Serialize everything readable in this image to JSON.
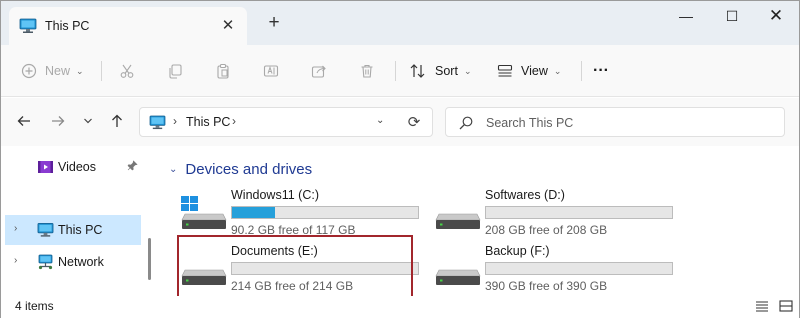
{
  "tab": {
    "title": "This PC",
    "icon": "this-pc-icon",
    "close": "✕"
  },
  "new_tab": "+",
  "window_controls": {
    "minimize": "—",
    "maximize": "☐",
    "close": "✕"
  },
  "commands": {
    "new_label": "New",
    "sort_label": "Sort",
    "view_label": "View",
    "more": "···",
    "icons": [
      "new-icon",
      "cut-icon",
      "copy-icon",
      "paste-icon",
      "rename-icon",
      "share-icon",
      "delete-icon",
      "sort-icon",
      "view-icon"
    ]
  },
  "address": {
    "location": "This PC",
    "separator": "›",
    "dropdown": "⌄",
    "refresh": "⟳",
    "search_placeholder": "Search This PC"
  },
  "sidebar": {
    "items": [
      {
        "label": "Videos",
        "icon": "videos-icon",
        "pinned": true
      },
      {
        "label": "This PC",
        "icon": "this-pc-icon",
        "selected": true
      },
      {
        "label": "Network",
        "icon": "network-icon"
      }
    ],
    "chevron": "›",
    "pin": "📌"
  },
  "content": {
    "group_title": "Devices and drives",
    "group_chevron": "⌄",
    "drives": [
      {
        "name": "Windows11 (C:)",
        "free_text": "90.2 GB free of 117 GB",
        "used_fraction": 0.229,
        "system": true
      },
      {
        "name": "Softwares (D:)",
        "free_text": "208 GB free of 208 GB",
        "used_fraction": 0.0
      },
      {
        "name": "Documents (E:)",
        "free_text": "214 GB free of 214 GB",
        "used_fraction": 0.0,
        "highlighted": true
      },
      {
        "name": "Backup (F:)",
        "free_text": "390 GB free of 390 GB",
        "used_fraction": 0.0
      }
    ]
  },
  "status": {
    "items_count": "4 items"
  },
  "colors": {
    "accent": "#26a0da",
    "selected_bg": "#cce8ff",
    "highlight_border": "#a2262c",
    "group_title": "#1f3a93"
  }
}
